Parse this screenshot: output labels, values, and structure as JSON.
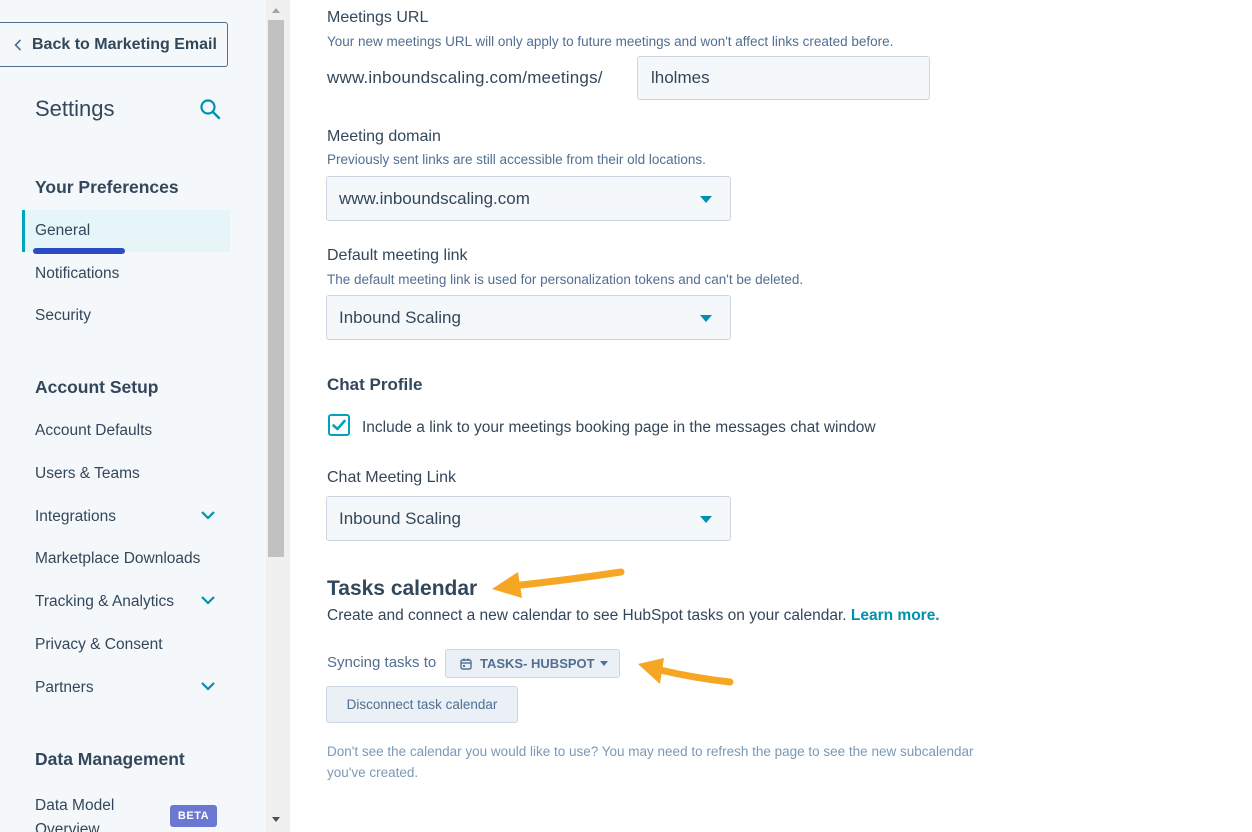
{
  "sidebar": {
    "back_label": "Back to Marketing Email",
    "title": "Settings",
    "sections": {
      "preferences": "Your Preferences",
      "account_setup": "Account Setup",
      "data_management": "Data Management"
    },
    "items": {
      "general": "General",
      "notifications": "Notifications",
      "security": "Security",
      "account_defaults": "Account Defaults",
      "users_teams": "Users & Teams",
      "integrations": "Integrations",
      "marketplace": "Marketplace Downloads",
      "tracking": "Tracking & Analytics",
      "privacy": "Privacy & Consent",
      "partners": "Partners",
      "data_model": "Data Model Overview"
    },
    "beta_badge": "BETA"
  },
  "meetings_url": {
    "label": "Meetings URL",
    "help": "Your new meetings URL will only apply to future meetings and won't affect links created before.",
    "prefix": "www.inboundscaling.com/meetings/",
    "value": "lholmes"
  },
  "meeting_domain": {
    "label": "Meeting domain",
    "help": "Previously sent links are still accessible from their old locations.",
    "value": "www.inboundscaling.com"
  },
  "default_link": {
    "label": "Default meeting link",
    "help": "The default meeting link is used for personalization tokens and can't be deleted.",
    "value": "Inbound Scaling"
  },
  "chat_profile": {
    "title": "Chat Profile",
    "checkbox_label": "Include a link to your meetings booking page in the messages chat window",
    "checked": true
  },
  "chat_meeting_link": {
    "label": "Chat Meeting Link",
    "value": "Inbound Scaling"
  },
  "tasks_calendar": {
    "title": "Tasks calendar",
    "description": "Create and connect a new calendar to see HubSpot tasks on your calendar.",
    "learn_more": "Learn more.",
    "syncing_label": "Syncing tasks to",
    "calendar_name": "TASKS- HUBSPOT",
    "disconnect_label": "Disconnect task calendar",
    "footer_note": "Don't see the calendar you would like to use? You may need to refresh the page to see the new subcalendar you've created."
  },
  "colors": {
    "accent": "#00a4bd",
    "link": "#0091ae",
    "annotation_arrow": "#f5a623",
    "annotation_underline": "#2b4cc4",
    "text": "#33475b"
  }
}
